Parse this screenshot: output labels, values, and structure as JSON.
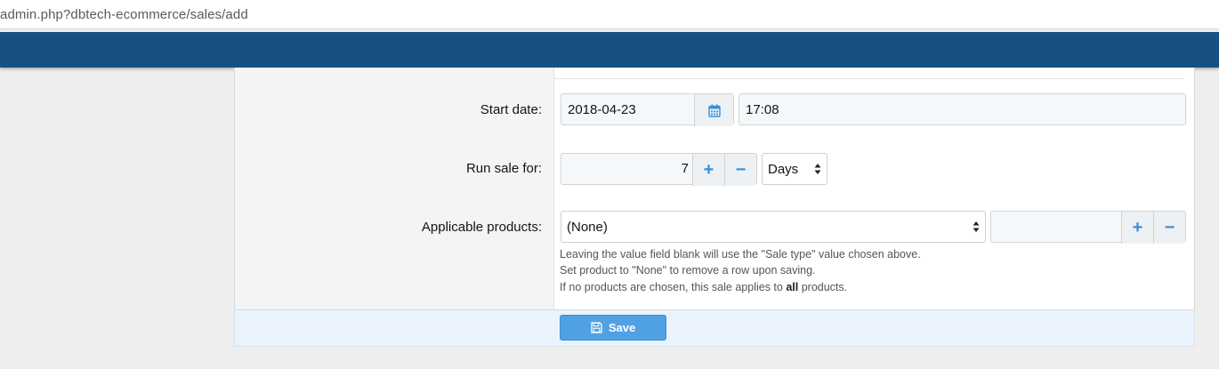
{
  "browser": {
    "url": "admin.php?dbtech-ecommerce/sales/add"
  },
  "form": {
    "start_date": {
      "label": "Start date:",
      "date_value": "2018-04-23",
      "time_value": "17:08",
      "calendar_icon": "calendar-icon"
    },
    "run_sale": {
      "label": "Run sale for:",
      "value": "7",
      "plus": "+",
      "minus": "−",
      "unit_selected": "Days"
    },
    "applicable_products": {
      "label": "Applicable products:",
      "product_selected": "(None)",
      "value": "",
      "plus": "+",
      "minus": "−",
      "hint_line1": "Leaving the value field blank will use the \"Sale type\" value chosen above.",
      "hint_line2": "Set product to \"None\" to remove a row upon saving.",
      "hint_line3_pre": "If no products are chosen, this sale applies to ",
      "hint_line3_bold": "all",
      "hint_line3_post": " products."
    },
    "save_label": "Save"
  },
  "colors": {
    "header_blue": "#185181",
    "button_blue": "#4fa1e3",
    "stepper_blue": "#3b8fd9"
  }
}
